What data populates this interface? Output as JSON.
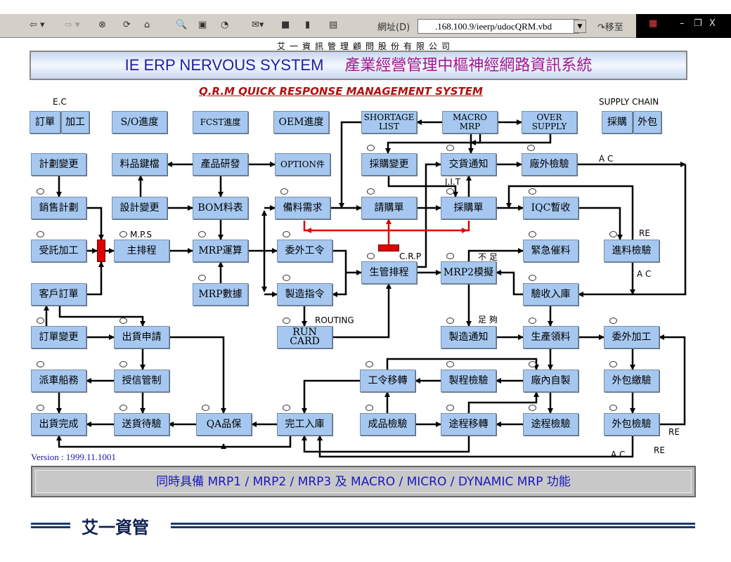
{
  "browser": {
    "address_label": "網址(D)",
    "address_value": ".168.100.9/ieerp/udocQRM.vbd",
    "go_label": "移至",
    "toolbar_icons": [
      "back-icon",
      "forward-icon",
      "stop-icon",
      "refresh-icon",
      "home-icon",
      "search-icon",
      "favorites-icon",
      "history-icon",
      "mail-icon",
      "print-icon",
      "edit-icon",
      "discuss-icon"
    ],
    "window_controls": [
      "minimize",
      "restore",
      "close"
    ]
  },
  "header": {
    "company": "艾一資訊管理顧問股份有限公司",
    "title_en": "IE ERP NERVOUS SYSTEM",
    "title_zh": "產業經營管理中樞神經網路資訊系統",
    "subtitle": "Q.R.M QUICK RESPONSE MANAGEMENT SYSTEM"
  },
  "diagram": {
    "section_labels": {
      "ec": "E.C",
      "supply_chain": "SUPPLY CHAIN"
    },
    "nodes": {
      "order": "訂單",
      "process": "加工",
      "so_progress": "S/O進度",
      "fcst_progress": "FCST進度",
      "oem_progress": "OEM進度",
      "shortage_list": "SHORTAGE LIST",
      "macro_mrp": "MACRO MRP",
      "over_supply": "OVER SUPPLY",
      "purchase": "採購",
      "outsource": "外包",
      "plan_change": "計劃變更",
      "item_master": "料品鍵檔",
      "product_rd": "產品研發",
      "option_part": "OPTION件",
      "po_change": "採購變更",
      "delivery_notice": "交貨通知",
      "external_inspection": "廠外檢驗",
      "sales_plan": "銷售計劃",
      "design_change": "設計變更",
      "bom": "BOM料表",
      "material_demand": "備料需求",
      "requisition": "請購單",
      "purchase_order": "採購單",
      "iqc_receipt": "IQC暫收",
      "consigned_processing": "受託加工",
      "master_schedule": "主排程",
      "mrp_run": "MRP運算",
      "subcontract_order": "委外工令",
      "urgent_expedite": "緊急催料",
      "incoming_inspection": "進料檢驗",
      "production_schedule": "生管排程",
      "mrp2_simulation": "MRP2模擬",
      "customer_order": "客戶訂單",
      "mrp_data": "MRP數據",
      "work_order": "製造指令",
      "receiving": "驗收入庫",
      "order_change": "訂單變更",
      "shipment_request": "出貨申請",
      "run_card": "RUN CARD",
      "mfg_notice": "製造通知",
      "material_issue": "生產領料",
      "subcontract_processing": "委外加工",
      "dispatch_shipping": "派車船務",
      "credit_control": "授信管制",
      "wo_transfer": "工令移轉",
      "process_inspection": "製程檢驗",
      "in_house": "廠內自製",
      "subcontract_submit": "外包繳驗",
      "shipment_complete": "出貨完成",
      "delivery_pending": "送貨待驗",
      "qa": "QA品保",
      "completion_storage": "完工入庫",
      "final_inspection": "成品檢驗",
      "routing_transfer": "途程移轉",
      "routing_inspection": "途程檢驗",
      "subcontract_inspection": "外包檢驗"
    },
    "annotations": {
      "mps": "M.P.S",
      "ac1": "A C",
      "jit": "J.I.T",
      "crp": "C.R.P",
      "shortage": "不 足",
      "re1": "RE",
      "ac2": "A C",
      "routing": "ROUTING",
      "sufficient": "足 夠",
      "re2": "RE",
      "re3": "RE",
      "ac3": "A C"
    }
  },
  "footer": {
    "version": "Version : 1999.11.1001",
    "feature_banner": "同時具備 MRP1 / MRP2 / MRP3 及 MACRO / MICRO / DYNAMIC MRP 功能",
    "logo_text": "艾一資管"
  },
  "colors": {
    "node_fill": "#a6c8f0",
    "title_en": "#2020a0",
    "title_zh": "#a01890",
    "subtitle": "#b01010",
    "crp_line": "#e00000",
    "version": "#1818b0"
  }
}
